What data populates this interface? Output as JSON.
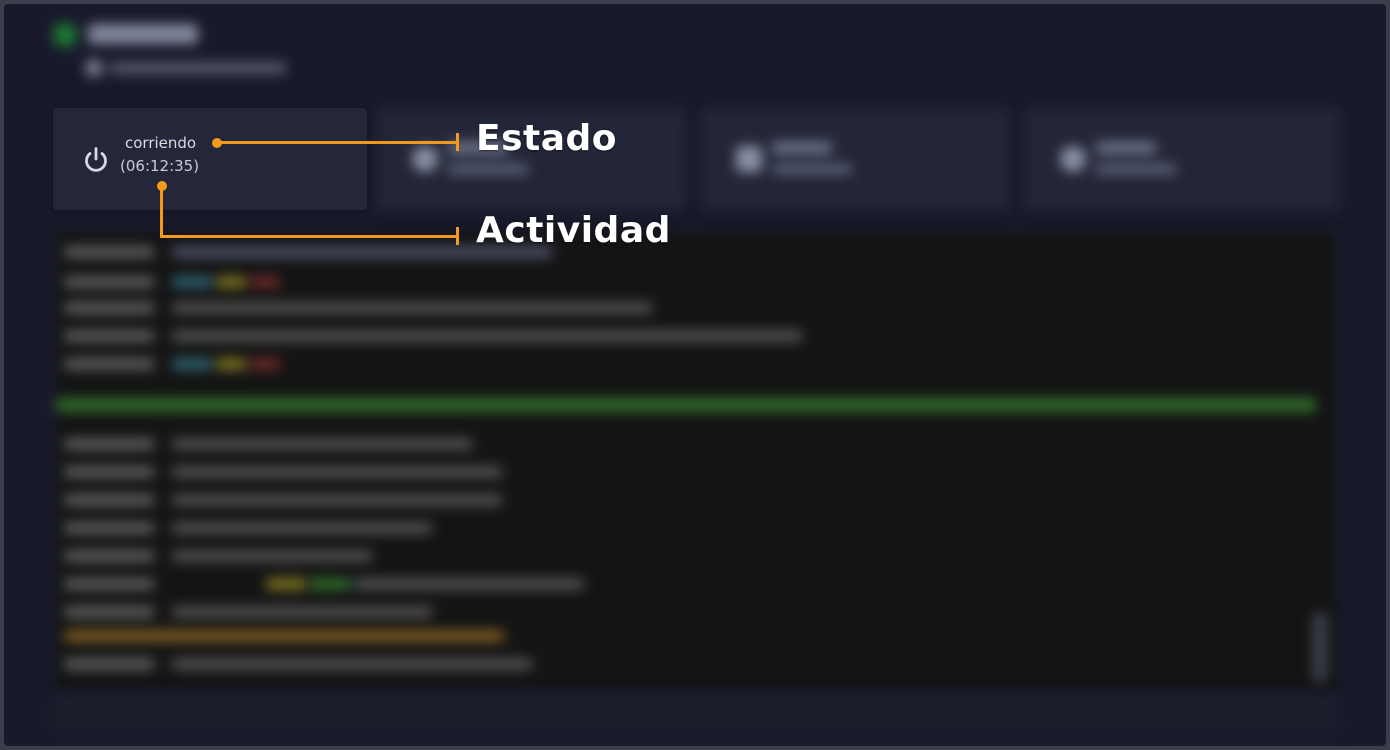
{
  "status_card": {
    "state": "corriendo",
    "uptime": "(06:12:35)",
    "icon": "power-icon"
  },
  "annotations": {
    "estado": "Estado",
    "actividad": "Actividad"
  },
  "colors": {
    "accent": "#f39a1b",
    "background": "#181a2b",
    "card": "#24273a",
    "terminal": "#141414"
  }
}
